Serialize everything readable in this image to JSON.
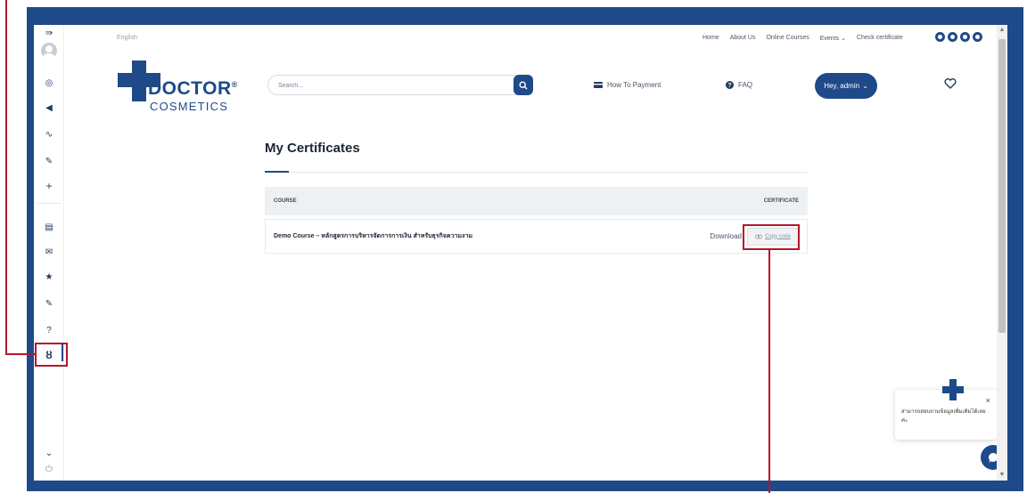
{
  "sidebar": {
    "items": [
      {
        "icon": "menu-expand-icon",
        "glyph": "⇛"
      },
      {
        "icon": "dashboard-icon",
        "glyph": "◎"
      },
      {
        "icon": "announcement-icon",
        "glyph": "◀"
      },
      {
        "icon": "analytics-icon",
        "glyph": "∿"
      },
      {
        "icon": "edit-icon",
        "glyph": "✎"
      },
      {
        "icon": "add-icon",
        "glyph": "+"
      },
      {
        "icon": "courses-icon",
        "glyph": "▤"
      },
      {
        "icon": "messages-icon",
        "glyph": "✉"
      },
      {
        "icon": "reviews-icon",
        "glyph": "★"
      },
      {
        "icon": "quiz-icon",
        "glyph": "✎"
      },
      {
        "icon": "help-icon",
        "glyph": "?"
      },
      {
        "icon": "certificate-icon",
        "glyph": "ȣ"
      },
      {
        "icon": "chevron-down-icon",
        "glyph": "⌄"
      },
      {
        "icon": "power-icon",
        "glyph": "⏻"
      }
    ]
  },
  "topbar": {
    "language": "English",
    "nav": [
      "Home",
      "About Us",
      "Online Courses",
      "Events",
      "Check certificate"
    ],
    "events_chevron": "⌄",
    "social_icons": [
      "facebook-icon",
      "instagram-icon",
      "youtube-icon",
      "line-icon"
    ]
  },
  "logo": {
    "brand": "DOCTOR",
    "registered": "®",
    "sub": "COSMETICS"
  },
  "search": {
    "placeholder": "Search..."
  },
  "header": {
    "how_to_payment": "How To Payment",
    "faq": "FAQ",
    "user_button": "Hey, admin",
    "user_caret": "⌄"
  },
  "page": {
    "title": "My Certificates"
  },
  "table": {
    "headers": {
      "course": "COURSE",
      "certificate": "CERTIFICATE"
    },
    "rows": [
      {
        "course": "Demo Course – หลักสูตรการบริหารจัดการการเงิน สำหรับธุรกิจความงาม",
        "download": "Download",
        "copy": "Copy code"
      }
    ]
  },
  "chat": {
    "popup_text": "สามารถสอบถามข้อมูลเพิ่มเติมได้เลยค่ะ",
    "close": "×"
  },
  "colors": {
    "brand": "#1e4a8a",
    "annotation": "#b3162a"
  }
}
